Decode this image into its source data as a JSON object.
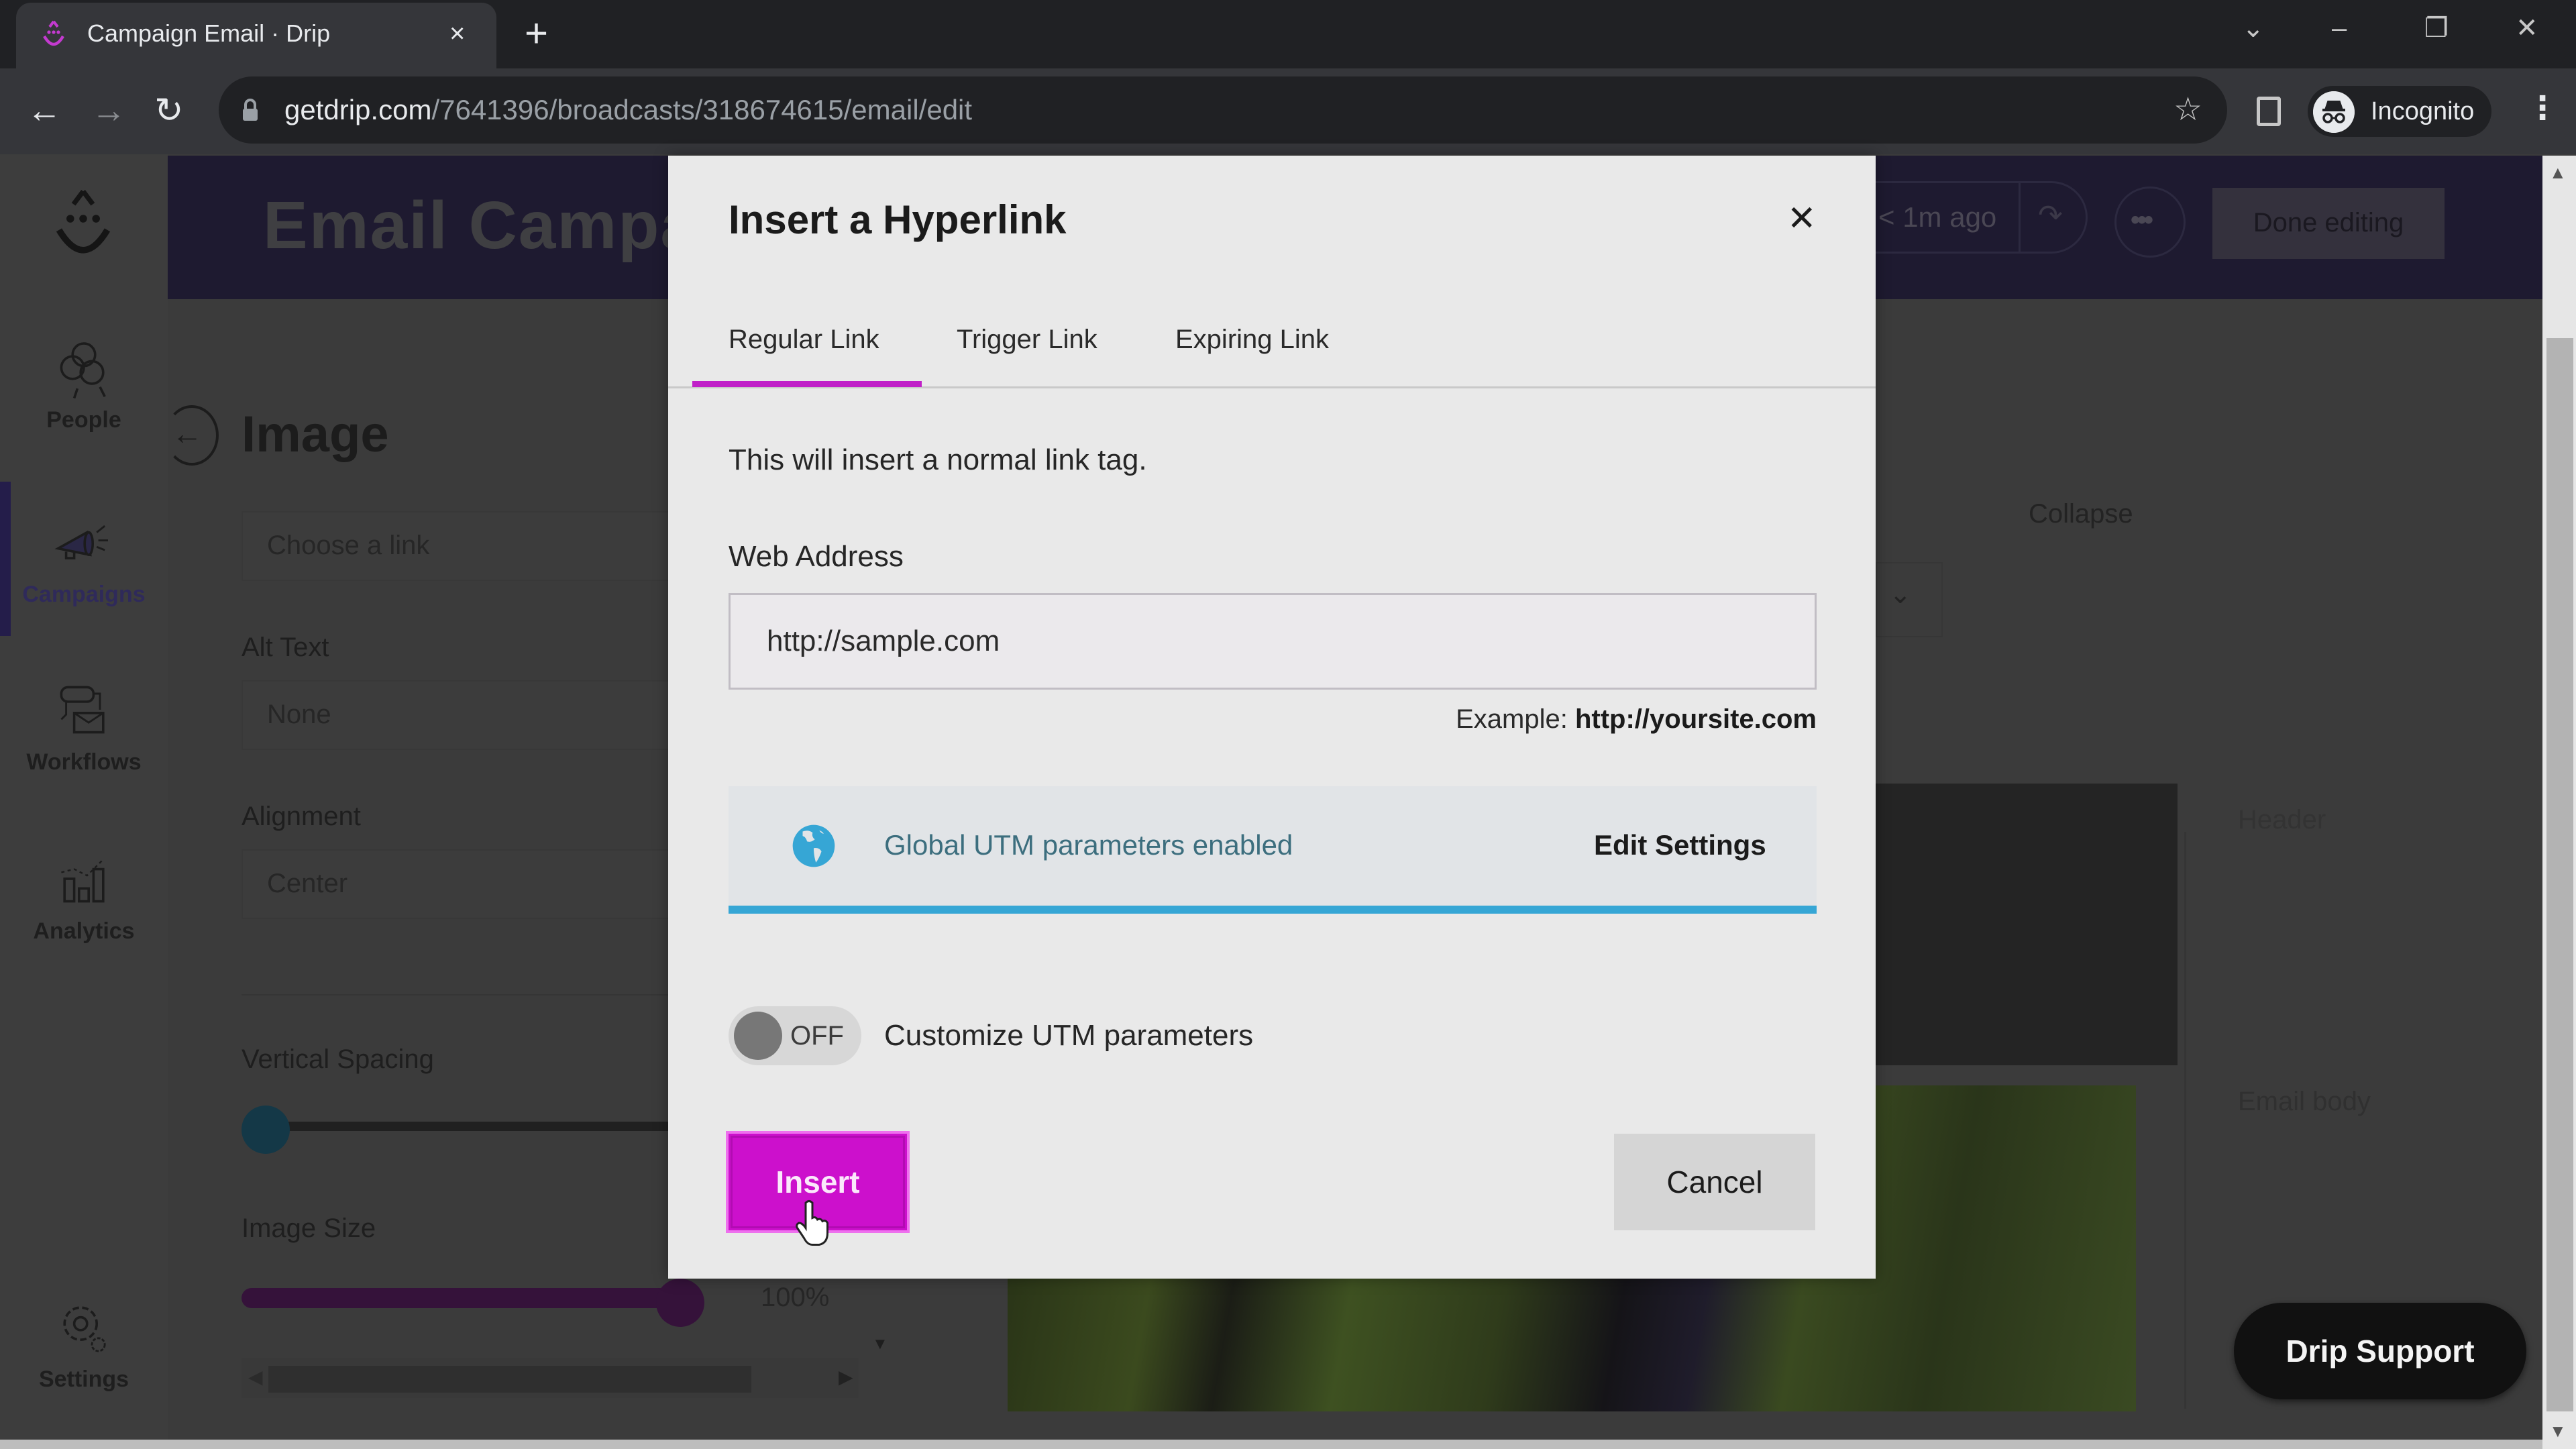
{
  "browser": {
    "tab_title": "Campaign Email · Drip",
    "tab_close": "×",
    "new_tab": "+",
    "url_host": "getdrip.com",
    "url_path": "/7641396/broadcasts/318674615/email/edit",
    "profile_label": "Incognito",
    "window_controls": {
      "tab_search": "⌄",
      "minimize": "–",
      "restore": "❐",
      "close": "✕"
    },
    "nav": {
      "back": "←",
      "forward": "→",
      "reload": "↻"
    },
    "star": "☆",
    "menu": "⋮"
  },
  "sidebar": {
    "items": [
      {
        "label": "People",
        "icon": "people-icon",
        "active": false
      },
      {
        "label": "Campaigns",
        "icon": "megaphone-icon",
        "active": true
      },
      {
        "label": "Workflows",
        "icon": "workflows-icon",
        "active": false
      },
      {
        "label": "Analytics",
        "icon": "analytics-icon",
        "active": false
      },
      {
        "label": "Settings",
        "icon": "gear-icon",
        "active": false
      }
    ]
  },
  "app_header": {
    "title": "Email Campa",
    "saved_status": "< 1m ago",
    "redo": "↷",
    "more": "•••",
    "done_label": "Done editing"
  },
  "left_panel": {
    "back": "←",
    "title": "Image",
    "link_placeholder": "Choose a link",
    "alt_text_label": "Alt Text",
    "alt_text_value": "None",
    "alignment_label": "Alignment",
    "alignment_value": "Center",
    "vertical_spacing_label": "Vertical Spacing",
    "vertical_spacing_value": 0,
    "image_size_label": "Image Size",
    "image_size_value": "100%",
    "image_size_fraction": 1.0
  },
  "canvas": {
    "collapse_label": "Collapse",
    "dropdown_chevron": "⌄",
    "header_label": "Header",
    "email_body_label": "Email body"
  },
  "support": {
    "label": "Drip Support"
  },
  "modal": {
    "title": "Insert a Hyperlink",
    "close": "✕",
    "tabs": [
      {
        "label": "Regular Link",
        "active": true
      },
      {
        "label": "Trigger Link",
        "active": false
      },
      {
        "label": "Expiring Link",
        "active": false
      }
    ],
    "description": "This will insert a normal link tag.",
    "web_address_label": "Web Address",
    "web_address_value": "http://sample.com",
    "example_prefix": "Example:",
    "example_value": "http://yoursite.com",
    "utm_notice": "Global UTM parameters enabled",
    "edit_settings": "Edit Settings",
    "customize_toggle": {
      "state": "OFF",
      "on": false
    },
    "customize_label": "Customize UTM parameters",
    "insert_label": "Insert",
    "cancel_label": "Cancel"
  },
  "colors": {
    "accent_magenta": "#cc10cc",
    "utm_blue": "#36a6d5",
    "header_navy": "#1e1a30"
  }
}
